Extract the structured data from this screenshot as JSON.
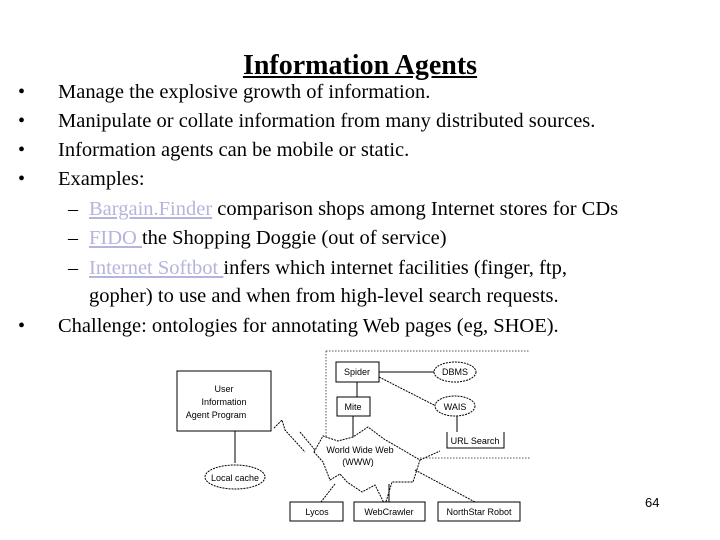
{
  "slide": {
    "title": "Information Agents",
    "page_number": "64",
    "link_color": "#b4b4dc"
  },
  "bullets": [
    {
      "text": "Manage the explosive growth of information."
    },
    {
      "text": "Manipulate or collate information from many distributed sources."
    },
    {
      "text": "Information agents can be mobile or static."
    },
    {
      "text": "Examples:"
    }
  ],
  "examples": [
    {
      "link": "Bargain.Finder",
      "text": " comparison shops among Internet stores for CDs"
    },
    {
      "link": "FIDO ",
      "text": "the Shopping Doggie (out of service)"
    },
    {
      "link": "Internet Softbot ",
      "text": "infers which internet facilities (finger, ftp,",
      "continuation": "gopher) to use and when from high-level search requests."
    }
  ],
  "final_bullet": {
    "text": "Challenge: ontologies for annotating Web pages (eg, SHOE)."
  },
  "diagram": {
    "user_agent": [
      "User",
      "Information",
      "Agent Program"
    ],
    "spider": "Spider",
    "mite": "Mite",
    "dbms": "DBMS",
    "wais": "WAIS",
    "url_search": "URL Search",
    "www": [
      "World Wide Web",
      "(WWW)"
    ],
    "local_cache": "Local cache",
    "lycos": "Lycos",
    "webcrawler": "WebCrawler",
    "northstar": "NorthStar Robot"
  }
}
